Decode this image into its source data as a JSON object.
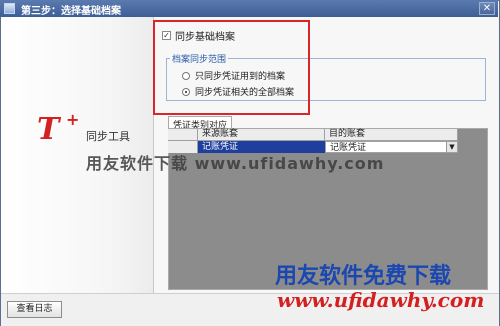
{
  "window": {
    "title": "第三步：选择基础档案",
    "close_glyph": "✕"
  },
  "logo": {
    "t": "T",
    "plus": "+",
    "text": "同步工具"
  },
  "sync_basic": {
    "label": "同步基础档案",
    "checked": true
  },
  "range_group": {
    "legend": "档案同步范围",
    "options": [
      {
        "label": "只同步凭证用到的档案",
        "selected": false
      },
      {
        "label": "同步凭证相关的全部档案",
        "selected": true
      }
    ]
  },
  "tab": {
    "label": "凭证类别对应"
  },
  "grid": {
    "columns": [
      "来源账套",
      "目的账套"
    ],
    "rows": [
      {
        "source": "记账凭证",
        "target": "记账凭证"
      }
    ]
  },
  "footer": {
    "view_log_button": "查看日志"
  },
  "watermark": {
    "middle": "用友软件下载 www.ufidawhy.com",
    "big": "用友软件免费下载",
    "url": "www.ufidawhy.com"
  },
  "colors": {
    "highlight_frame": "#d9262a",
    "title_bar": "#4a689f",
    "selection": "#1f3f9e"
  }
}
